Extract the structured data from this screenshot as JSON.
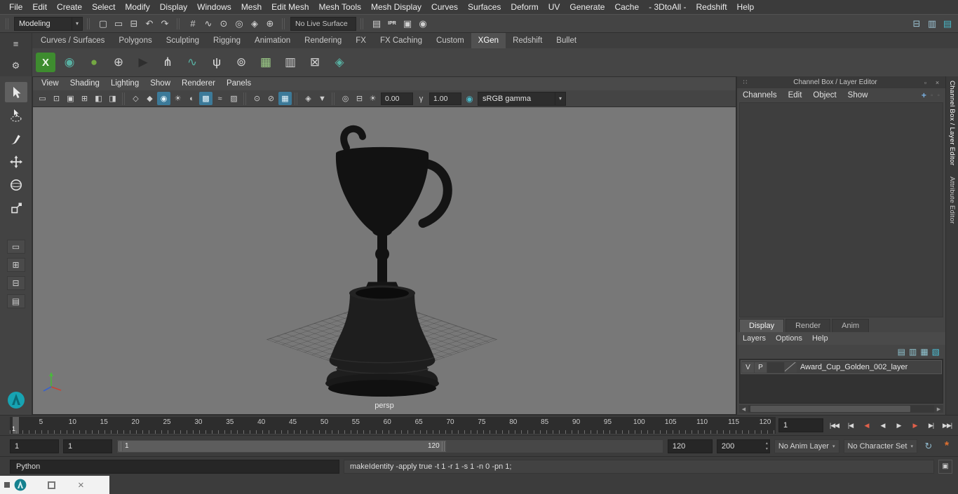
{
  "colors": {
    "highlight": "#3c7a99",
    "xgen_green": "#3e8c2f",
    "viewport_bg": "#787878",
    "key_red": "#e0604a"
  },
  "menubar": {
    "items": [
      "File",
      "Edit",
      "Create",
      "Select",
      "Modify",
      "Display",
      "Windows",
      "Mesh",
      "Edit Mesh",
      "Mesh Tools",
      "Mesh Display",
      "Curves",
      "Surfaces",
      "Deform",
      "UV",
      "Generate",
      "Cache",
      "- 3DtoAll -",
      "Redshift",
      "Help"
    ]
  },
  "status": {
    "mode": "Modeling",
    "live_surface": "No Live Surface",
    "file_icons": [
      {
        "name": "new-scene-icon",
        "glyph": "▢"
      },
      {
        "name": "open-scene-icon",
        "glyph": "▭"
      },
      {
        "name": "save-scene-icon",
        "glyph": "⊟"
      },
      {
        "name": "undo-icon",
        "glyph": "↶"
      },
      {
        "name": "redo-icon",
        "glyph": "↷"
      }
    ],
    "snap_icons": [
      {
        "name": "snap-to-grid-icon",
        "glyph": "#"
      },
      {
        "name": "snap-to-curve-icon",
        "glyph": "∿"
      },
      {
        "name": "snap-to-point-icon",
        "glyph": "⊙"
      },
      {
        "name": "snap-to-projected-center-icon",
        "glyph": "◎"
      },
      {
        "name": "make-live-icon",
        "glyph": "◈"
      },
      {
        "name": "snap-together-icon",
        "glyph": "⊕"
      }
    ],
    "render_icons": [
      {
        "name": "render-current-frame-icon",
        "glyph": "▤"
      },
      {
        "name": "ipr-render-icon",
        "glyph": "IPR",
        "cls": "chip"
      },
      {
        "name": "render-settings-icon",
        "glyph": "▣"
      },
      {
        "name": "hypershade-icon",
        "glyph": "◉"
      }
    ],
    "sidebar_icons": [
      {
        "name": "modeling-toolkit-toggle-icon",
        "glyph": "⊟",
        "color": "#9cc3d4"
      },
      {
        "name": "channel-box-toggle-icon",
        "glyph": "▥",
        "color": "#9cc3d4"
      },
      {
        "name": "attribute-editor-toggle-icon",
        "glyph": "▤",
        "color": "#49b8c8"
      }
    ]
  },
  "shelf": {
    "tabs": [
      {
        "label": "Curves / Surfaces"
      },
      {
        "label": "Polygons"
      },
      {
        "label": "Sculpting"
      },
      {
        "label": "Rigging"
      },
      {
        "label": "Animation"
      },
      {
        "label": "Rendering"
      },
      {
        "label": "FX"
      },
      {
        "label": "FX Caching"
      },
      {
        "label": "Custom"
      },
      {
        "label": "XGen",
        "cls": "active"
      },
      {
        "label": "Redshift"
      },
      {
        "label": "Bullet"
      }
    ],
    "xgen_icons": [
      {
        "name": "xgen-open-editor-icon",
        "glyph": "X"
      },
      {
        "name": "xgen-create-description-icon",
        "glyph": "◉",
        "color": "#58b0a2"
      },
      {
        "name": "xgen-create-collection-icon",
        "glyph": "●",
        "color": "#74a843"
      },
      {
        "name": "xgen-append-description-icon",
        "glyph": "⊕",
        "color": "#cfcfcf"
      },
      {
        "name": "xgen-export-selection-icon",
        "glyph": "▶",
        "color": "#2e2e2e"
      },
      {
        "name": "xgen-guide-tool-icon",
        "glyph": "⋔",
        "color": "#e0e0e0"
      },
      {
        "name": "xgen-curve-to-guide-icon",
        "glyph": "∿",
        "color": "#58b0a2"
      },
      {
        "name": "xgen-groomable-spline-icon",
        "glyph": "ψ",
        "color": "#e0e0e0"
      },
      {
        "name": "xgen-preview-refresh-icon",
        "glyph": "⊚",
        "color": "#cfcfcf"
      },
      {
        "name": "xgen-density-mask-icon",
        "glyph": "▦",
        "color": "#9fd08a"
      },
      {
        "name": "xgen-region-mask-icon",
        "glyph": "▥",
        "color": "#cfcfcf"
      },
      {
        "name": "xgen-clear-preview-icon",
        "glyph": "⊠",
        "color": "#cfcfcf"
      },
      {
        "name": "xgen-interactive-groom-icon",
        "glyph": "◈",
        "color": "#58b0a2"
      }
    ]
  },
  "toolbox": {
    "layout_buttons": [
      {
        "name": "single-pane-layout-button",
        "glyph": "▭"
      },
      {
        "name": "four-pane-layout-button",
        "glyph": "⊞"
      },
      {
        "name": "two-pane-layout-button",
        "glyph": "⊟"
      },
      {
        "name": "outliner-persp-layout-button",
        "glyph": "▤"
      }
    ]
  },
  "viewport": {
    "menus": [
      "View",
      "Shading",
      "Lighting",
      "Show",
      "Renderer",
      "Panels"
    ],
    "toolbar_icons": [
      {
        "name": "film-gate-icon",
        "glyph": "▭"
      },
      {
        "name": "resolution-gate-icon",
        "glyph": "⊡"
      },
      {
        "name": "gate-mask-icon",
        "glyph": "▣"
      },
      {
        "name": "field-chart-icon",
        "glyph": "⊞"
      },
      {
        "name": "safe-action-icon",
        "glyph": "◧"
      },
      {
        "name": "safe-title-icon",
        "glyph": "◨"
      },
      {
        "name": "toolbar-divider",
        "cls": "divider"
      },
      {
        "name": "wireframe-icon",
        "glyph": "◇"
      },
      {
        "name": "shaded-icon",
        "glyph": "◆"
      },
      {
        "name": "textured-icon",
        "glyph": "◉",
        "cls": "hl"
      },
      {
        "name": "use-all-lights-icon",
        "glyph": "☀"
      },
      {
        "name": "shadows-icon",
        "glyph": "◐"
      },
      {
        "name": "screen-space-ao-icon",
        "glyph": "▩",
        "cls": "hl"
      },
      {
        "name": "motion-blur-icon",
        "glyph": "≈"
      },
      {
        "name": "anti-aliasing-icon",
        "glyph": "▨"
      },
      {
        "name": "toolbar-divider",
        "cls": "divider"
      },
      {
        "name": "isolate-select-icon",
        "glyph": "⊙"
      },
      {
        "name": "xray-icon",
        "glyph": "⊘"
      },
      {
        "name": "wireframe-on-shaded-icon",
        "glyph": "▦",
        "cls": "hl"
      },
      {
        "name": "toolbar-divider",
        "cls": "divider"
      },
      {
        "name": "plugin-filter-icon",
        "glyph": "◈"
      },
      {
        "name": "scene-filter-icon",
        "glyph": "▼"
      },
      {
        "name": "toolbar-divider",
        "cls": "divider"
      },
      {
        "name": "snapshot-icon",
        "glyph": "◎"
      },
      {
        "name": "pane-layout-icon",
        "glyph": "⊟"
      }
    ],
    "exposure": "0.00",
    "gamma": "1.00",
    "colorspace": "sRGB gamma",
    "camera_label": "persp"
  },
  "channel_box": {
    "title": "Channel Box / Layer Editor",
    "menus": [
      "Channels",
      "Edit",
      "Object",
      "Show"
    ],
    "display_tabs": [
      {
        "label": "Display",
        "cls": "active"
      },
      {
        "label": "Render"
      },
      {
        "label": "Anim"
      }
    ],
    "layer_menus": [
      "Layers",
      "Options",
      "Help"
    ],
    "layer_icons": [
      {
        "name": "layers-sort-icon",
        "glyph": "▤"
      },
      {
        "name": "new-empty-layer-icon",
        "glyph": "▥"
      },
      {
        "name": "new-layer-from-selected-icon",
        "glyph": "▦"
      },
      {
        "name": "layer-options-icon",
        "glyph": "▧",
        "color": "#4cc3d9"
      }
    ],
    "layer_row": {
      "visibility": "V",
      "playback": "P",
      "name": "Award_Cup_Golden_002_layer"
    }
  },
  "side_tabs": [
    {
      "label": "Channel Box / Layer Editor",
      "cls": "active"
    },
    {
      "label": "Attribute Editor"
    }
  ],
  "timeline": {
    "tick_labels": [
      "5",
      "10",
      "15",
      "20",
      "25",
      "30",
      "35",
      "40",
      "45",
      "50",
      "55",
      "60",
      "65",
      "70",
      "75",
      "80",
      "85",
      "90",
      "95",
      "100",
      "105",
      "110",
      "115",
      "120"
    ],
    "current_frame": "1",
    "frame_field": "1",
    "transport": [
      {
        "name": "go-to-start-button",
        "glyph": "|◀◀"
      },
      {
        "name": "step-back-frame-button",
        "glyph": "|◀"
      },
      {
        "name": "step-back-key-button",
        "glyph": "◀",
        "cls": "key"
      },
      {
        "name": "play-backwards-button",
        "glyph": "◀"
      },
      {
        "name": "play-forwards-button",
        "glyph": "▶"
      },
      {
        "name": "step-forward-key-button",
        "glyph": "▶",
        "cls": "key"
      },
      {
        "name": "step-forward-frame-button",
        "glyph": "▶|"
      },
      {
        "name": "go-to-end-button",
        "glyph": "▶▶|"
      }
    ]
  },
  "range": {
    "animation_start": "1",
    "playback_start": "1",
    "bar_start_label": "1",
    "bar_end_label": "120",
    "playback_end": "120",
    "animation_end": "200",
    "anim_layer": "No Anim Layer",
    "character_set": "No Character Set"
  },
  "command_line": {
    "language": "Python",
    "help_line": "makeIdentity -apply true -t 1 -r 1 -s 1 -n 0 -pn 1;"
  },
  "taskbar": {
    "close_glyph": "×"
  }
}
